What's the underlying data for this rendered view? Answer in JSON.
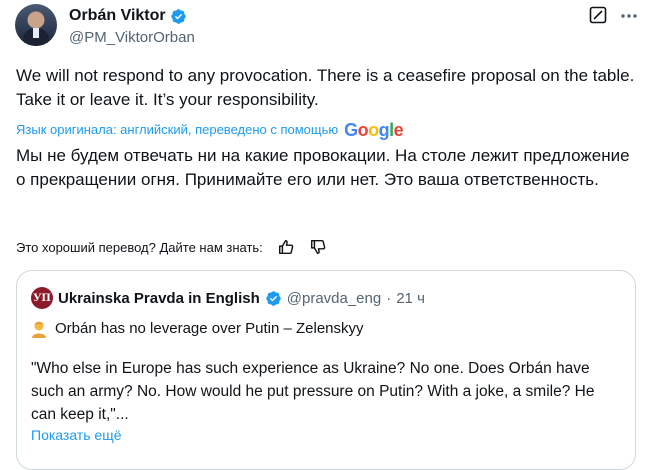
{
  "author": {
    "name": "Orbán Viktor",
    "handle": "@PM_ViktorOrban"
  },
  "tweet": {
    "text_en": "We will not respond to any provocation. There is a ceasefire proposal on the table. Take it or leave it. It’s your responsibility.",
    "translation_note": "Язык оригинала: английский, переведено с помощью",
    "translation_provider": "Google",
    "text_ru": "Мы не будем отвечать ни на какие провокации. На столе лежит предложение о прекращении огня. Принимайте его или нет. Это ваша ответственность."
  },
  "feedback": {
    "prompt": "Это хороший перевод? Дайте нам знать:"
  },
  "quoted": {
    "name": "Ukrainska Pravda in English",
    "handle": "@pravda_eng",
    "dot": "·",
    "time": "21 ч",
    "logo_text": "УП",
    "headline": "Orbán has no leverage over Putin – Zelenskyy",
    "text": "\"Who else in Europe has such experience as Ukraine? No one. Does Orbán have such an army? No. How would he put pressure on Putin? With a joke, a smile? He can keep it,\"...",
    "show_more": "Показать ещё"
  },
  "colors": {
    "link": "#1d9bf0",
    "secondary_text": "#536471",
    "verified": "#1d9bf0",
    "border": "#cfd9de",
    "logo_bg": "#8b1a2b"
  },
  "icons": [
    "verified-badge-icon",
    "grok-icon",
    "more-options-icon",
    "thumbs-up-icon",
    "thumbs-down-icon",
    "person-emoji-icon"
  ]
}
